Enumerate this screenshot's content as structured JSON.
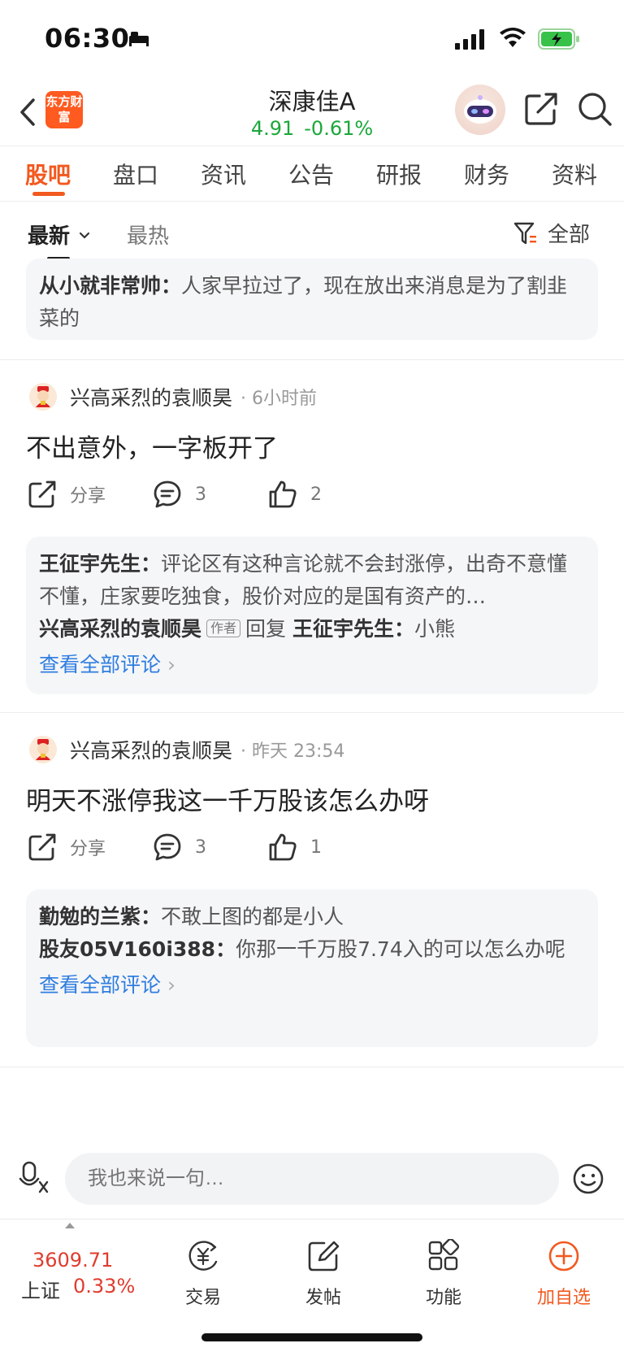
{
  "status_bar": {
    "time": "06:30"
  },
  "header": {
    "brand_logo_text": "东方财富",
    "stock_name": "深康佳A",
    "price": "4.91",
    "change_pct": "-0.61%"
  },
  "tabs": [
    {
      "label": "股吧",
      "active": true
    },
    {
      "label": "盘口"
    },
    {
      "label": "资讯"
    },
    {
      "label": "公告"
    },
    {
      "label": "研报"
    },
    {
      "label": "财务"
    },
    {
      "label": "资料"
    }
  ],
  "sort": {
    "newest": "最新",
    "hot": "最热",
    "filter_label": "全部"
  },
  "top_quote": {
    "author": "从小就非常帅：",
    "text": "人家早拉过了，现在放出来消息是为了割韭菜的"
  },
  "posts": [
    {
      "author": "兴高采烈的袁顺昊",
      "time": "· 6小时前",
      "content": "不出意外，一字板开了",
      "share_label": "分享",
      "comment_count": "3",
      "like_count": "2",
      "comments": [
        {
          "author": "王征宇先生：",
          "text": "评论区有这种言论就不会封涨停，出奇不意懂不懂，庄家要吃独食，股价对应的是国有资产的…"
        }
      ],
      "reply": {
        "author": "兴高采烈的袁顺昊",
        "tag": "作者",
        "verb": "回复",
        "target": "王征宇先生：",
        "text": "小熊"
      },
      "view_all": "查看全部评论"
    },
    {
      "author": "兴高采烈的袁顺昊",
      "time": "· 昨天 23:54",
      "content": "明天不涨停我这一千万股该怎么办呀",
      "share_label": "分享",
      "comment_count": "3",
      "like_count": "1",
      "comments": [
        {
          "author": "勤勉的兰紫：",
          "text": "不敢上图的都是小人"
        },
        {
          "author": "股友05V160i388：",
          "text": "你那一千万股7.74入的可以怎么办呢"
        }
      ],
      "view_all": "查看全部评论"
    }
  ],
  "input_bar": {
    "placeholder": "我也来说一句…"
  },
  "bottom_nav": {
    "index_value": "3609.71",
    "index_name": "上证",
    "index_change": "0.33%",
    "items": [
      {
        "label": "交易",
        "icon": "trade-icon"
      },
      {
        "label": "发帖",
        "icon": "edit-icon"
      },
      {
        "label": "功能",
        "icon": "grid-icon"
      },
      {
        "label": "加自选",
        "icon": "add-circle-icon"
      }
    ]
  },
  "colors": {
    "accent": "#f2591f",
    "up": "#e03c2e",
    "down": "#1aa83a",
    "link": "#2f7de0"
  }
}
